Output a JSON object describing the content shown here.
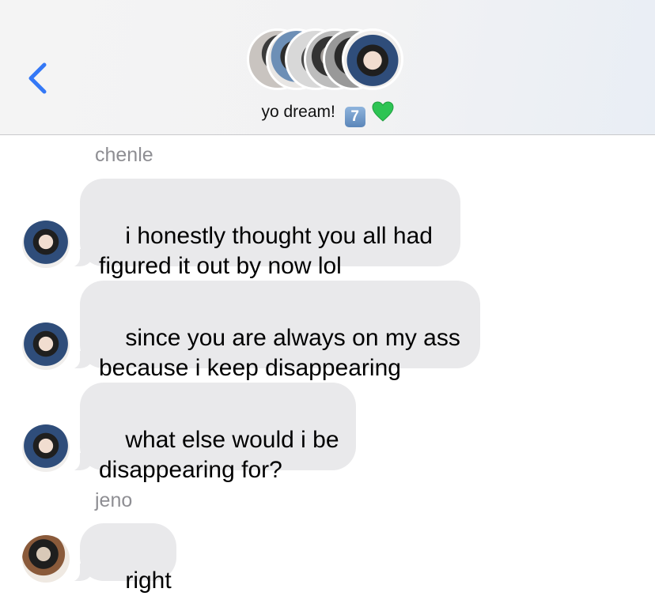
{
  "header": {
    "group_name": "yo dream!",
    "emoji_keycap": "7",
    "emoji_heart": "green-heart-icon",
    "back_icon": "chevron-left-icon",
    "accent_color": "#3478f6"
  },
  "messages": [
    {
      "sender": "chenle",
      "text": "i honestly thought you all had\nfigured it out by now lol"
    },
    {
      "sender": "chenle",
      "text": "since you are always on my ass\nbecause i keep disappearing"
    },
    {
      "sender": "chenle",
      "text": "what else would i be\ndisappearing for?"
    },
    {
      "sender": "jeno",
      "text": "right"
    }
  ],
  "colors": {
    "bubble_incoming": "#e9e9eb",
    "sender_label": "#8e8e93"
  }
}
